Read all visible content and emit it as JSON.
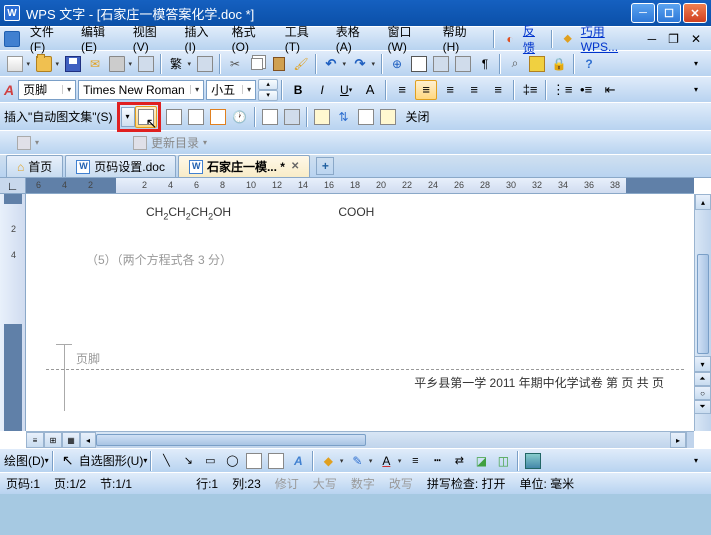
{
  "title": "WPS 文字 - [石家庄一模答案化学.doc *]",
  "menubar": [
    "文件(F)",
    "编辑(E)",
    "视图(V)",
    "插入(I)",
    "格式(O)",
    "工具(T)",
    "表格(A)",
    "窗口(W)",
    "帮助(H)"
  ],
  "feedback": "反馈",
  "wpslink": "巧用WPS...",
  "style_combo": "页脚",
  "font_combo": "Times New Roman",
  "size_combo": "小五",
  "autotext_label": "插入\"自动图文集\"(S)",
  "close_btn": "关闭",
  "update_toc": "更新目录",
  "tabs": [
    {
      "label": "首页",
      "home": true
    },
    {
      "label": "页码设置.doc"
    },
    {
      "label": "石家庄一模... *",
      "active": true
    }
  ],
  "ruler_h": [
    "6",
    "4",
    "2",
    "2",
    "4",
    "6",
    "8",
    "10",
    "12",
    "14",
    "16",
    "18",
    "20",
    "22",
    "24",
    "26",
    "28",
    "30",
    "32",
    "34",
    "36",
    "38"
  ],
  "ruler_v": [
    "2",
    "4"
  ],
  "chem1": "CH₂CH₂CH₂OH",
  "chem2": "COOH",
  "line5": "（5）（两个方程式各 3 分）",
  "footer_label": "页脚",
  "footer_text": "平乡县第一学 2011 年期中化学试卷    第    页  共     页",
  "draw_label": "绘图(D)",
  "autoshapes": "自选图形(U)",
  "status": {
    "pageno": "页码:1",
    "page": "页:1/2",
    "sec": "节:1/1",
    "row": "行:1",
    "col": "列:23",
    "rev": "修订",
    "caps": "大写",
    "num": "数字",
    "ovr": "改写",
    "spell": "拼写检查: 打开",
    "unit": "单位: 毫米"
  },
  "chart_data": null
}
